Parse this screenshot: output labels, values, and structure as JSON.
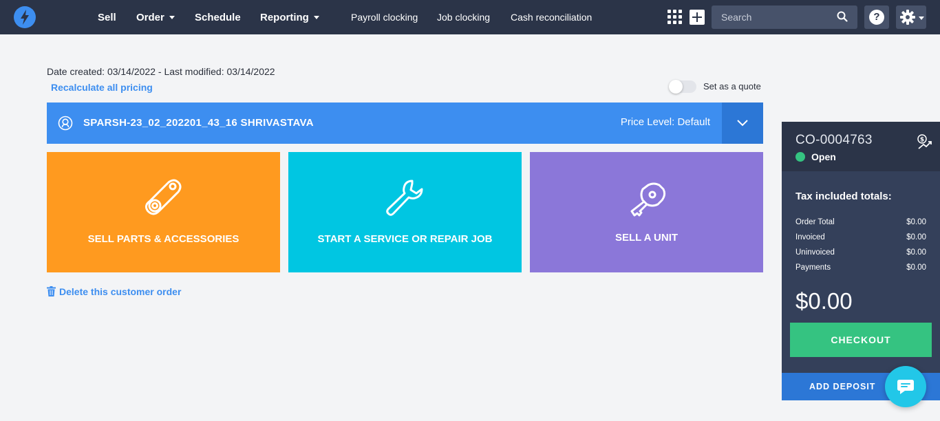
{
  "nav": {
    "main": [
      {
        "label": "Sell",
        "dropdown": false
      },
      {
        "label": "Order",
        "dropdown": true
      },
      {
        "label": "Schedule",
        "dropdown": false
      },
      {
        "label": "Reporting",
        "dropdown": true
      }
    ],
    "secondary": [
      "Payroll clocking",
      "Job clocking",
      "Cash reconciliation"
    ],
    "search_placeholder": "Search",
    "help_label": "?"
  },
  "order_meta": {
    "dates": "Date created: 03/14/2022 - Last modified: 03/14/2022",
    "recalculate": "Recalculate all pricing",
    "quote_toggle_label": "Set as a quote",
    "quote_enabled": false
  },
  "customer": {
    "name": "SPARSH-23_02_202201_43_16 SHRIVASTAVA",
    "price_level": "Price Level: Default"
  },
  "tiles": [
    {
      "label": "SELL PARTS & ACCESSORIES",
      "icon": "parts-icon",
      "color": "#ff9a1f"
    },
    {
      "label": "START A SERVICE OR REPAIR JOB",
      "icon": "wrench-icon",
      "color": "#00c6e2"
    },
    {
      "label": "SELL A UNIT",
      "icon": "key-icon",
      "color": "#8b77d9"
    }
  ],
  "delete_link": "Delete this customer order",
  "panel": {
    "order_id": "CO-0004763",
    "status": "Open",
    "tax_title": "Tax included totals:",
    "totals": [
      {
        "label": "Order Total",
        "value": "$0.00"
      },
      {
        "label": "Invoiced",
        "value": "$0.00"
      },
      {
        "label": "Uninvoiced",
        "value": "$0.00"
      },
      {
        "label": "Payments",
        "value": "$0.00"
      }
    ],
    "grand_total": "$0.00",
    "checkout_label": "CHECKOUT",
    "deposit_label": "ADD DEPOSIT"
  },
  "colors": {
    "topbar": "#2b3448",
    "accent": "#3d8ef0",
    "success": "#35c381",
    "panel": "#34405a"
  }
}
